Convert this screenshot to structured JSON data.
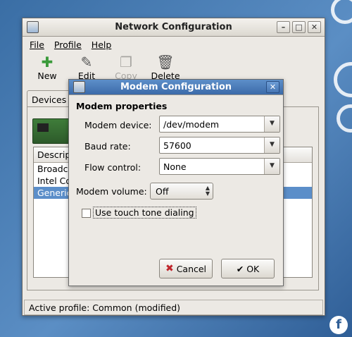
{
  "main_window": {
    "title": "Network Configuration",
    "menu": [
      "File",
      "Profile",
      "Help"
    ],
    "toolbar": [
      {
        "label": "New",
        "icon": "new-icon",
        "enabled": true
      },
      {
        "label": "Edit",
        "icon": "edit-icon",
        "enabled": true
      },
      {
        "label": "Copy",
        "icon": "copy-icon",
        "enabled": false
      },
      {
        "label": "Delete",
        "icon": "delete-icon",
        "enabled": true
      }
    ],
    "tab": "Devices",
    "list_header": "Descript",
    "list_items": [
      "Broadco",
      "Intel Co",
      "Generic"
    ],
    "status": "Active profile: Common (modified)"
  },
  "modem_dialog": {
    "title": "Modem Configuration",
    "section": "Modem properties",
    "modem_device_label": "Modem device:",
    "modem_device_value": "/dev/modem",
    "baud_rate_label": "Baud rate:",
    "baud_rate_value": "57600",
    "flow_control_label": "Flow control:",
    "flow_control_value": "None",
    "volume_label": "Modem volume:",
    "volume_value": "Off",
    "touch_tone_label": "Use touch tone dialing",
    "touch_tone_checked": false,
    "cancel_label": "Cancel",
    "ok_label": "OK"
  },
  "colors": {
    "dialog_title": "#4a7ebd",
    "selection": "#5b8ec9",
    "cancel_icon": "#c0262d"
  }
}
